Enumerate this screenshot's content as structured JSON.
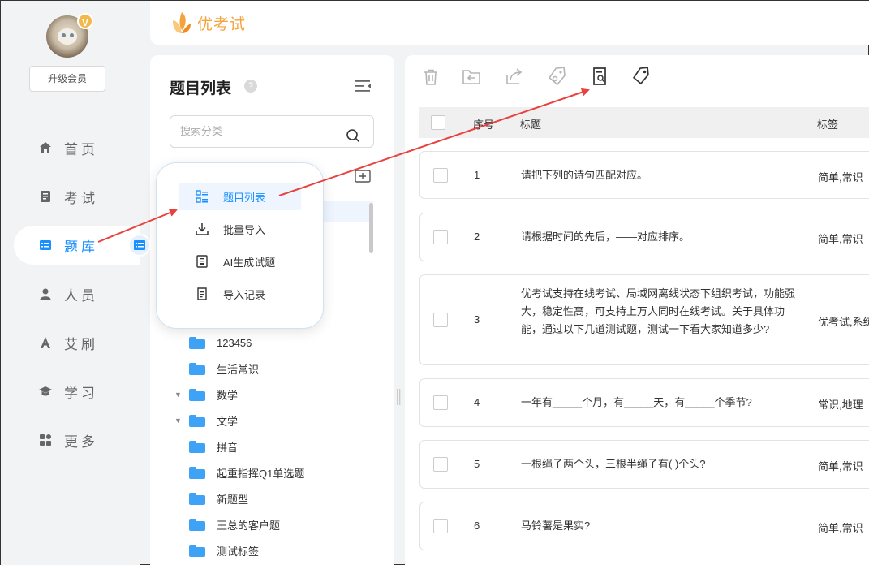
{
  "brand": {
    "name": "优考试",
    "color": "#f5a23c"
  },
  "user": {
    "badge": "V",
    "upgrade_label": "升级会员"
  },
  "nav": [
    {
      "label": "首页",
      "icon": "home-icon"
    },
    {
      "label": "考试",
      "icon": "exam-icon"
    },
    {
      "label": "题库",
      "icon": "question-bank-icon",
      "active": true
    },
    {
      "label": "人员",
      "icon": "person-icon"
    },
    {
      "label": "艾刷",
      "icon": "ai-brush-icon"
    },
    {
      "label": "学习",
      "icon": "graduation-cap-icon"
    },
    {
      "label": "更多",
      "icon": "more-grid-icon"
    }
  ],
  "tree": {
    "title": "题目列表",
    "help": "?",
    "search_placeholder": "搜索分类",
    "items": [
      {
        "label": "123456",
        "expanded": null
      },
      {
        "label": "生活常识",
        "expanded": null
      },
      {
        "label": "数学",
        "expanded": true
      },
      {
        "label": "文学",
        "expanded": true
      },
      {
        "label": "拼音",
        "expanded": null
      },
      {
        "label": "起重指挥Q1单选题",
        "expanded": null
      },
      {
        "label": "新题型",
        "expanded": null
      },
      {
        "label": "王总的客户题",
        "expanded": null
      },
      {
        "label": "测试标签",
        "expanded": null
      }
    ]
  },
  "popup": [
    {
      "label": "题目列表",
      "icon": "list-icon",
      "active": true
    },
    {
      "label": "批量导入",
      "icon": "download-icon"
    },
    {
      "label": "AI生成试题",
      "icon": "ai-doc-icon"
    },
    {
      "label": "导入记录",
      "icon": "record-icon"
    }
  ],
  "toolbar": [
    {
      "name": "delete-icon"
    },
    {
      "name": "move-folder-icon"
    },
    {
      "name": "export-icon"
    },
    {
      "name": "tag-search-icon"
    },
    {
      "name": "doc-search-icon",
      "highlighted": true
    },
    {
      "name": "tag-icon",
      "highlighted": true
    }
  ],
  "table": {
    "headers": {
      "index": "序号",
      "title": "标题",
      "tag": "标签"
    },
    "rows": [
      {
        "num": "1",
        "title": "请把下列的诗句匹配对应。",
        "tag": "简单,常识"
      },
      {
        "num": "2",
        "title": "请根据时间的先后，——对应排序。",
        "tag": "简单,常识"
      },
      {
        "num": "3",
        "title": "优考试支持在线考试、局域网离线状态下组织考试，功能强大，稳定性高，可支持上万人同时在线考试。关于具体功能，通过以下几道测试题，测试一下看大家知道多少?",
        "tag": "优考试,系统"
      },
      {
        "num": "4",
        "title": "一年有_____个月，有_____天，有_____个季节?",
        "tag": "常识,地理"
      },
      {
        "num": "5",
        "title": "一根绳子两个头，三根半绳子有(     )个头?",
        "tag": "简单,常识"
      },
      {
        "num": "6",
        "title": "马铃薯是果实?",
        "tag": "简单,常识"
      }
    ]
  },
  "colors": {
    "accent": "#1890ff",
    "arrow": "#e8413e",
    "folder": "#3ea2f7"
  }
}
